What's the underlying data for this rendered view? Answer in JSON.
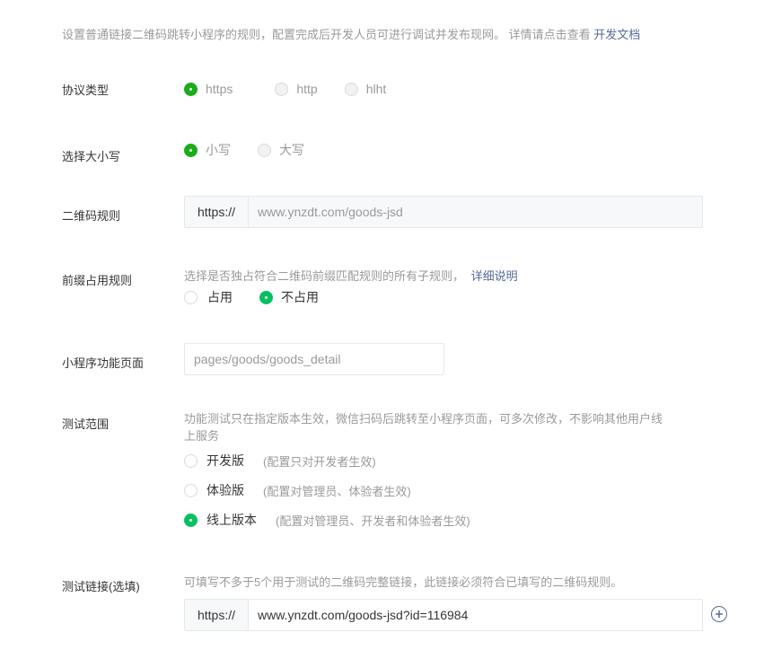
{
  "intro": {
    "text": "设置普通链接二维码跳转小程序的规则，配置完成后开发人员可进行调试并发布现网。 详情请点击查看",
    "link": "开发文档"
  },
  "protocol": {
    "label": "协议类型",
    "options": [
      "https",
      "http",
      "hlht"
    ],
    "selected": "https"
  },
  "case": {
    "label": "选择大小写",
    "options": [
      "小写",
      "大写"
    ],
    "selected": "小写"
  },
  "qr_rule": {
    "label": "二维码规则",
    "prefix": "https://",
    "value": "www.ynzdt.com/goods-jsd"
  },
  "prefix_rule": {
    "label": "前缀占用规则",
    "hint": "选择是否独占符合二维码前缀匹配规则的所有子规则，",
    "hint_link": "详细说明",
    "options": [
      "占用",
      "不占用"
    ],
    "selected": "不占用"
  },
  "page": {
    "label": "小程序功能页面",
    "value": "pages/goods/goods_detail"
  },
  "test_scope": {
    "label": "测试范围",
    "hint_line1": "功能测试只在指定版本生效，微信扫码后跳转至小程序页面，可多次修改，不影响其他用户线",
    "hint_line2": "上服务",
    "options": [
      {
        "name": "开发版",
        "note": "(配置只对开发者生效)"
      },
      {
        "name": "体验版",
        "note": "(配置对管理员、体验者生效)"
      },
      {
        "name": "线上版本",
        "note": "(配置对管理员、开发者和体验者生效)"
      }
    ],
    "selected": "线上版本"
  },
  "test_link": {
    "label": "测试链接(选填)",
    "hint": "可填写不多于5个用于测试的二维码完整链接，此链接必须符合已填写的二维码规则。",
    "prefix": "https://",
    "value": "www.ynzdt.com/goods-jsd?id=116984",
    "add_icon": "plus-circle-icon"
  }
}
